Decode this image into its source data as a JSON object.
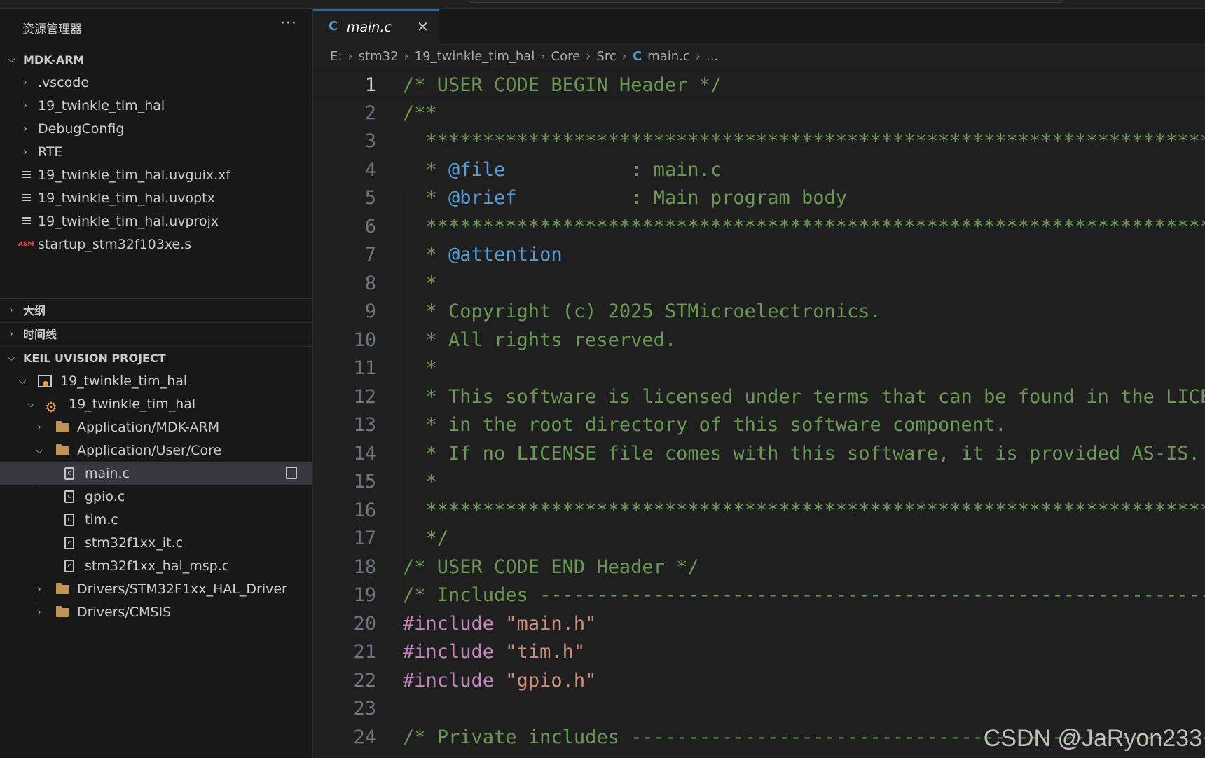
{
  "explorer": {
    "title": "资源管理器",
    "more": "···",
    "root": "MDK-ARM",
    "items": [
      {
        "label": ".vscode",
        "kind": "folder"
      },
      {
        "label": "19_twinkle_tim_hal",
        "kind": "folder"
      },
      {
        "label": "DebugConfig",
        "kind": "folder"
      },
      {
        "label": "RTE",
        "kind": "folder"
      },
      {
        "label": "19_twinkle_tim_hal.uvguix.xf",
        "kind": "file"
      },
      {
        "label": "19_twinkle_tim_hal.uvoptx",
        "kind": "file"
      },
      {
        "label": "19_twinkle_tim_hal.uvprojx",
        "kind": "file"
      },
      {
        "label": "startup_stm32f103xe.s",
        "kind": "asm",
        "badge": "ASM"
      }
    ]
  },
  "outline": {
    "title": "大纲"
  },
  "timeline": {
    "title": "时间线"
  },
  "keil": {
    "title": "KEIL UVISION PROJECT",
    "project": "19_twinkle_tim_hal",
    "target": "19_twinkle_tim_hal",
    "groups": [
      "Application/MDK-ARM",
      "Application/User/Core"
    ],
    "files": [
      "main.c",
      "gpio.c",
      "tim.c",
      "stm32f1xx_it.c",
      "stm32f1xx_hal_msp.c"
    ],
    "groups_after": [
      "Drivers/STM32F1xx_HAL_Driver",
      "Drivers/CMSIS"
    ]
  },
  "editor": {
    "tab": {
      "icon": "C",
      "label": "main.c",
      "close": "✕"
    },
    "breadcrumb": [
      "E:",
      "stm32",
      "19_twinkle_tim_hal",
      "Core",
      "Src",
      "main.c",
      "..."
    ],
    "lines": [
      {
        "n": "1",
        "text": "/* USER CODE BEGIN Header */"
      },
      {
        "n": "2",
        "text": "/**"
      },
      {
        "n": "3",
        "text": "  ******************************************************************************"
      },
      {
        "n": "4",
        "pre": "  * ",
        "tag": "@file",
        "post": "           : main.c"
      },
      {
        "n": "5",
        "pre": "  * ",
        "tag": "@brief",
        "post": "          : Main program body"
      },
      {
        "n": "6",
        "text": "  ******************************************************************************"
      },
      {
        "n": "7",
        "pre": "  * ",
        "tag": "@attention",
        "post": ""
      },
      {
        "n": "8",
        "text": "  *"
      },
      {
        "n": "9",
        "text": "  * Copyright (c) 2025 STMicroelectronics."
      },
      {
        "n": "10",
        "text": "  * All rights reserved."
      },
      {
        "n": "11",
        "text": "  *"
      },
      {
        "n": "12",
        "text": "  * This software is licensed under terms that can be found in the LICENSE file"
      },
      {
        "n": "13",
        "text": "  * in the root directory of this software component."
      },
      {
        "n": "14",
        "text": "  * If no LICENSE file comes with this software, it is provided AS-IS."
      },
      {
        "n": "15",
        "text": "  *"
      },
      {
        "n": "16",
        "text": "  ******************************************************************************"
      },
      {
        "n": "17",
        "text": "  */"
      },
      {
        "n": "18",
        "text": "/* USER CODE END Header */"
      },
      {
        "n": "19",
        "text": "/* Includes ------------------------------------------------------------------*/"
      },
      {
        "n": "20",
        "kw": "#include",
        "str": " \"main.h\""
      },
      {
        "n": "21",
        "kw": "#include",
        "str": " \"tim.h\""
      },
      {
        "n": "22",
        "kw": "#include",
        "str": " \"gpio.h\""
      },
      {
        "n": "23",
        "text": ""
      },
      {
        "n": "24",
        "text": "/* Private includes ----------------------------------------------------------*/"
      }
    ]
  },
  "watermark": "CSDN @JaRyon233"
}
